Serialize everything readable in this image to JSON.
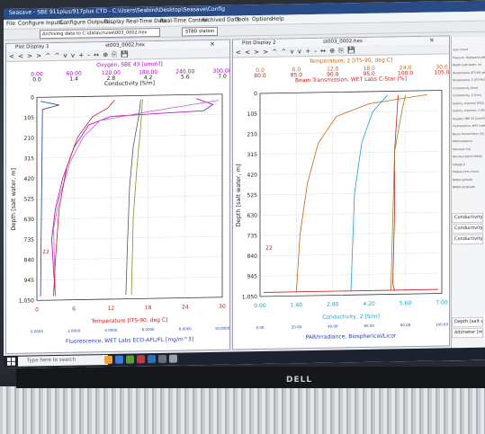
{
  "app": {
    "title": "Seasave - SBE 911plus/917plus CTD - C:\\Users\\Seabird\\Desktop\\Seasave\\Config",
    "menu": [
      "File",
      "Configure Inputs...",
      "Configure Outputs...",
      "Display",
      "Real-Time Data",
      "Real-Time Control",
      "Archived Data",
      "Tools",
      "Options",
      "Help"
    ],
    "file_field": "Archiving data to C:\\data\\cruise\\003_0002.hex",
    "status": "STBD station"
  },
  "plot1": {
    "window_title": "Plot Display 1",
    "window_file": "st003_0002.hex",
    "toolbar": "< < > > ^ ^ v v + - ↔ ⊕ ⎘ 💾",
    "axes": [
      {
        "label": "Oxygen, SBE 43 [umol/l]",
        "ticks": [
          "0.00",
          "60.00",
          "120.00",
          "180.00",
          "240.00",
          "300.00"
        ],
        "color": "#b400c8"
      },
      {
        "label": "Conductivity [S/m]",
        "ticks": [
          "0.0",
          "1.4",
          "2.8",
          "4.2",
          "5.6",
          "7.0"
        ],
        "color": "#202020"
      },
      {
        "label": "Temperature [ITS-90, deg C]",
        "ticks": [
          "0",
          "6",
          "12",
          "18",
          "24",
          "30"
        ],
        "color": "#c81e1e"
      },
      {
        "label": "Fluorescence, WET Labs ECO-AFL/FL [mg/m^3]",
        "ticks": [
          "0.0000",
          "2.0000",
          "4.0000",
          "6.0000",
          "8.0000",
          "10.0000"
        ],
        "color": "#1e3cb4"
      }
    ],
    "ylabel": "Depth [salt water, m]",
    "depth_ticks": [
      "0",
      "105",
      "210",
      "315",
      "420",
      "525",
      "630",
      "735",
      "840",
      "945",
      "1,050"
    ],
    "marker": "22"
  },
  "plot2": {
    "window_title": "Plot Display 2",
    "window_file": "st003_0002.hex",
    "toolbar": "< < > > ^ ^ v v + - ↔ ⊕ ⎘ 💾",
    "axes": [
      {
        "label": "Temperature, 2 [ITS-90, deg C]",
        "ticks": [
          "0.0",
          "6.0",
          "12.0",
          "18.0",
          "24.0",
          "30.0"
        ],
        "color": "#c86414"
      },
      {
        "label": "Beam Transmission, WET Labs C-Star [%]",
        "ticks": [
          "80.0",
          "85.0",
          "90.0",
          "95.0",
          "100.0",
          "105.0"
        ],
        "color": "#c81e1e"
      },
      {
        "label": "Conductivity, 2 [S/m]",
        "ticks": [
          "0.00",
          "1.40",
          "2.80",
          "4.20",
          "5.60",
          "7.00"
        ],
        "color": "#1ea0c8"
      },
      {
        "label": "PAR/Irradiance, Biospherical/Licor",
        "ticks": [
          "0.00",
          "20.00",
          "40.00",
          "60.00",
          "80.00",
          "100.00"
        ],
        "color": "#1e3cb4"
      }
    ],
    "ylabel": "Depth [salt water, m]",
    "depth_ticks": [
      "0",
      "105",
      "210",
      "315",
      "420",
      "525",
      "630",
      "735",
      "840",
      "945",
      "1,050"
    ],
    "marker": "22"
  },
  "side_panel": {
    "items": [
      "Scan Count",
      "Pressure, Digiquartz [db]",
      "Depth [salt water, m]",
      "Temperature [ITS-90, deg C]",
      "Temperature, 2 [ITS-90]",
      "Conductivity [S/m]",
      "Conductivity, 2 [S/m]",
      "Salinity, Practical [PSU]",
      "Salinity, Practical, 2 [PSU]",
      "Oxygen, SBE 43 [umol/l]",
      "Fluorescence, WET Labs",
      "Beam Transmission [%]",
      "PAR/Irradiance",
      "Altimeter [m]",
      "Density [sigma-theta]",
      "Voltage 0",
      "Module Error Count",
      "NMEA Latitude",
      "NMEA Longitude"
    ],
    "big_labels": [
      "Conductivity [S",
      "Conductivity, 2",
      "Conductivity D"
    ],
    "bottom_labels": [
      "Depth [salt wa",
      "Altimeter [m]"
    ]
  },
  "taskbar": {
    "search": "Type here to search"
  },
  "monitor": {
    "brand": "DELL"
  }
}
